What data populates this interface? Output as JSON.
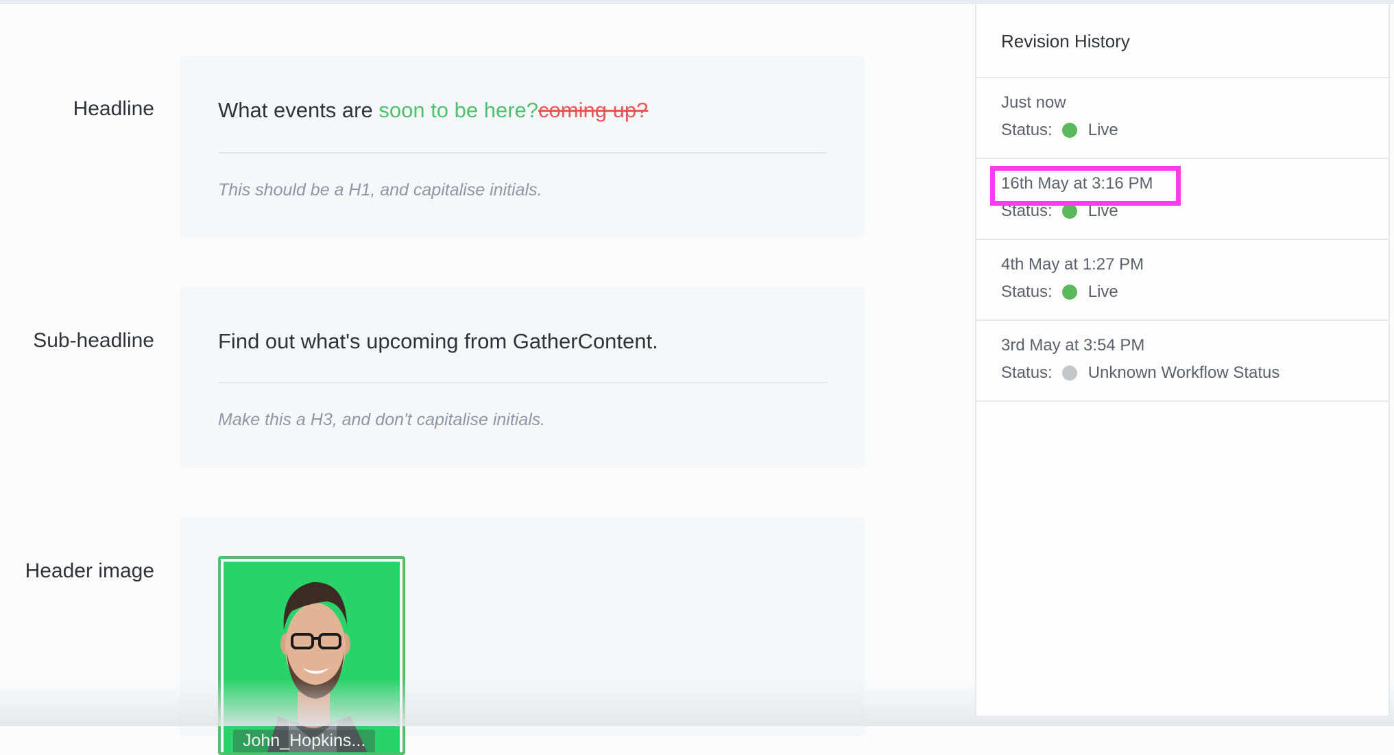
{
  "fields": {
    "headline": {
      "label": "Headline",
      "value_plain": "What events are ",
      "value_inserted": "soon to be here?",
      "value_deleted": "coming up?",
      "hint": "This should be a H1, and capitalise initials."
    },
    "subheadline": {
      "label": "Sub-headline",
      "value": "Find out what's upcoming from GatherContent.",
      "hint": "Make this a H3, and don't capitalise initials."
    },
    "header_image": {
      "label": "Header image",
      "caption": "John_Hopkins..."
    }
  },
  "sidebar": {
    "title": "Revision History",
    "status_prefix": "Status:",
    "revisions": [
      {
        "date": "Just now",
        "status": "Live",
        "status_color": "#5cb85c"
      },
      {
        "date": "16th May at 3:16 PM",
        "status": "Live",
        "status_color": "#5cb85c"
      },
      {
        "date": "4th May at 1:27 PM",
        "status": "Live",
        "status_color": "#5cb85c"
      },
      {
        "date": "3rd May at 3:54 PM",
        "status": "Unknown Workflow Status",
        "status_color": "#c4c6c9"
      }
    ]
  },
  "colors": {
    "inserted": "#4cc26e",
    "deleted": "#e8575a",
    "highlight": "#ff3cf1",
    "image_background": "#2ad36a"
  }
}
